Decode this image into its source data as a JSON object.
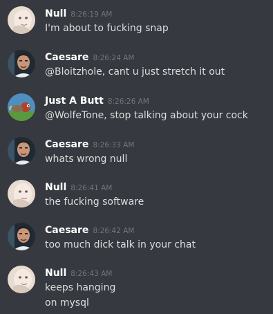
{
  "messages": [
    {
      "author": "Null",
      "avatar": "null-avatar",
      "time": "8:26:19 AM",
      "lines": [
        "I'm about to fucking snap"
      ]
    },
    {
      "author": "Caesare",
      "avatar": "caesare-avatar",
      "time": "8:26:24 AM",
      "lines": [
        "@Bloitzhole, cant u just stretch it out"
      ]
    },
    {
      "author": "Just A Butt",
      "avatar": "just-a-butt-avatar",
      "time": "8:26:26 AM",
      "lines": [
        "@WolfeTone, stop talking about your cock"
      ]
    },
    {
      "author": "Caesare",
      "avatar": "caesare-avatar",
      "time": "8:26:33 AM",
      "lines": [
        "whats wrong null"
      ]
    },
    {
      "author": "Null",
      "avatar": "null-avatar",
      "time": "8:26:41 AM",
      "lines": [
        "the fucking software"
      ]
    },
    {
      "author": "Caesare",
      "avatar": "caesare-avatar",
      "time": "8:26:42 AM",
      "lines": [
        "too much dick talk in your chat"
      ]
    },
    {
      "author": "Null",
      "avatar": "null-avatar",
      "time": "8:26:43 AM",
      "lines": [
        "keeps hanging",
        "on mysql"
      ]
    }
  ]
}
